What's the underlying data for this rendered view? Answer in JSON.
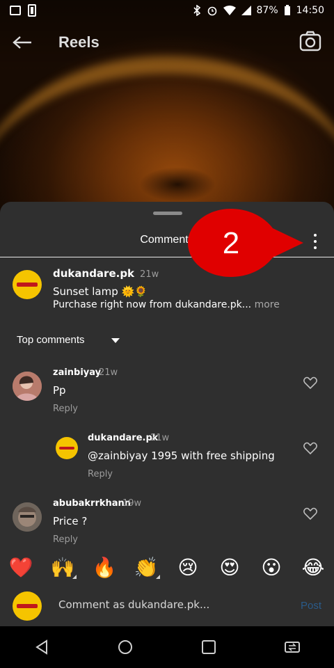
{
  "status_bar": {
    "battery": "87%",
    "time": "14:50"
  },
  "top_bar": {
    "title": "Reels"
  },
  "sheet": {
    "title": "Comments",
    "annotation_number": "2"
  },
  "caption": {
    "username": "dukandare.pk",
    "time": "21w",
    "line1": "Sunset lamp 🌞🌻",
    "line2": "Purchase right now from dukandare.pk...",
    "more": " more"
  },
  "sort": {
    "label": "Top comments"
  },
  "comments": [
    {
      "username": "zainbiyay",
      "time": "21w",
      "text": "Pp",
      "reply": "Reply"
    },
    {
      "username": "dukandare.pk",
      "time": "21w",
      "text": "@zainbiyay 1995 with free shipping",
      "reply": "Reply"
    },
    {
      "username": "abubakrrkhann",
      "time": "19w",
      "text": "Price ?",
      "reply": "Reply"
    }
  ],
  "emojis": [
    "❤️",
    "🙌",
    "🔥",
    "👏",
    "😢",
    "😍",
    "😮",
    "😂"
  ],
  "input": {
    "placeholder": "Comment as dukandare.pk...",
    "post": "Post"
  },
  "colors": {
    "sheet_bg": "#2f2f2f",
    "callout_red": "#e00000",
    "brand_yellow": "#f5c400",
    "post_blue": "#2a5b8a"
  }
}
